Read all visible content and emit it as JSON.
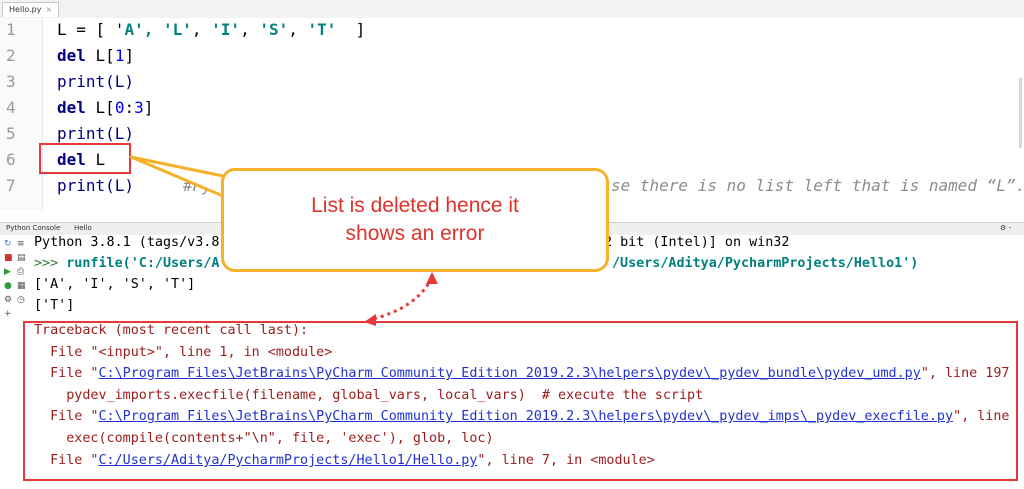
{
  "editor": {
    "tab_label": "Hello.py",
    "tab_close": "×",
    "line_numbers": [
      "1",
      "2",
      "3",
      "4",
      "5",
      "6",
      "7"
    ],
    "line1": {
      "a": "L = [ '",
      "b": "A",
      "c": "', ",
      "d": "'L'",
      "e": ", ",
      "f": "'I'",
      "g": ", ",
      "h": "'S'",
      "i": ", ",
      "j": "'T'",
      "k": "  ]"
    },
    "line2": {
      "kw": "del",
      "rest": " L[",
      "num": "1",
      "end": "]"
    },
    "line3": "print(L)",
    "line4": {
      "kw": "del",
      "rest": " L[",
      "num": "0",
      "mid": ":",
      "num2": "3",
      "end": "]"
    },
    "line5": "print(L)",
    "line6": {
      "kw": "del",
      "rest": " L"
    },
    "line7": {
      "code": "print(L)",
      "comment_start": "#Py",
      "comment_end": "se there is no list left that is named “L”."
    }
  },
  "console_tabs": {
    "python_console": "Python Console",
    "hello": "Hello",
    "settings": "⚙ -"
  },
  "console": {
    "line1": "Python 3.8.1 (tags/v3.8",
    "line1_end": "2 bit (Intel)] on win32",
    "prompt": ">>>",
    "run_start": " runfile('C:/Users/A",
    "run_end": "/Users/Aditya/PycharmProjects/Hello1')",
    "out1": "['A', 'I', 'S', 'T']",
    "out2": "['T']",
    "tb_header": "Traceback (most recent call last):",
    "tb1": "  File \"<input>\", line 1, in <module>",
    "tb2_pre": "  File \"",
    "tb2_link": "C:\\Program Files\\JetBrains\\PyCharm Community Edition 2019.2.3\\helpers\\pydev\\_pydev_bundle\\pydev_umd.py",
    "tb2_post": "\", line 197",
    "tb3": "    pydev_imports.execfile(filename, global_vars, local_vars)  # execute the script",
    "tb4_pre": "  File \"",
    "tb4_link": "C:\\Program Files\\JetBrains\\PyCharm Community Edition 2019.2.3\\helpers\\pydev\\_pydev_imps\\_pydev_execfile.py",
    "tb4_post": "\", line",
    "tb5": "    exec(compile(contents+\"\\n\", file, 'exec'), glob, loc)",
    "tb6_pre": "  File \"",
    "tb6_link": "C:/Users/Aditya/PycharmProjects/Hello1/Hello.py",
    "tb6_post": "\", line 7, in <module>"
  },
  "callout": {
    "line1": "List is deleted hence it",
    "line2": "shows an error"
  },
  "colors": {
    "callout_border": "#f5b12a",
    "annotation_red": "#e63a3a",
    "callout_text": "#e0322a"
  }
}
